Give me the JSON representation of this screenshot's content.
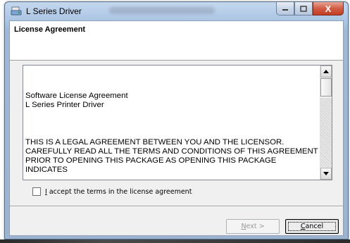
{
  "window": {
    "title": "L Series Driver",
    "icon": "printer-setup-icon",
    "controls": {
      "minimize": "minimize-icon",
      "maximize": "maximize-icon",
      "close_glyph": "X"
    }
  },
  "header": {
    "title": "License Agreement"
  },
  "license": {
    "lines": [
      "Software License Agreement",
      " L Series Printer Driver",
      "THIS IS A LEGAL AGREEMENT BETWEEN YOU AND THE LICENSOR.",
      "CAREFULLY READ ALL THE TERMS AND CONDITIONS OF THIS AGREEMENT",
      "PRIOR TO OPENING THIS PACKAGE AS OPENING THIS PACKAGE INDICATES"
    ]
  },
  "accept": {
    "mnemonic": "I",
    "label_rest": " accept the terms in the license agreement",
    "checked": false
  },
  "buttons": {
    "next_mnemonic": "N",
    "next_rest": "ext >",
    "next_enabled": false,
    "cancel_mnemonic": "C",
    "cancel_rest": "ancel"
  },
  "colors": {
    "close_button": "#c23c22",
    "title_bar": "#a9c3e3",
    "dialog_bg": "#f0f0f0"
  }
}
